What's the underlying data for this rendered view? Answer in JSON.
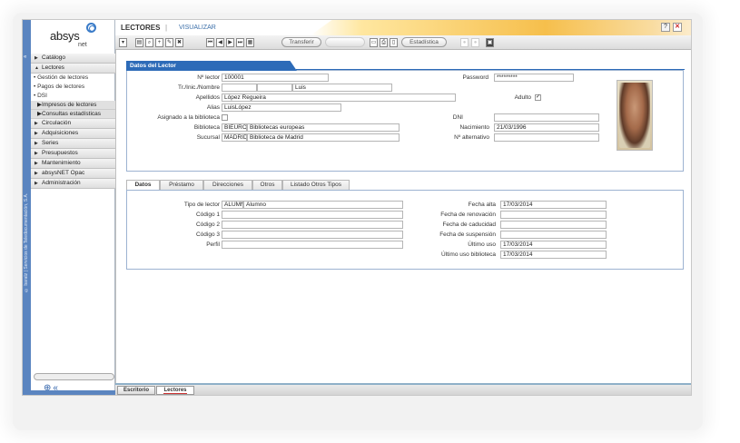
{
  "app": {
    "logo_word": "absys",
    "logo_suffix": "net",
    "vertical_credit": "© baratz | Servicios de Teledocumentación, S.A."
  },
  "window": {
    "module_title": "LECTORES",
    "separator": "|",
    "mode": "VISUALIZAR",
    "help_label": "?",
    "close_label": "✕"
  },
  "toolbar": {
    "transfer_label": "Transferir",
    "stats_label": "Estadística"
  },
  "sidebar": {
    "items": [
      {
        "label": "Catálogo",
        "expanded": false
      },
      {
        "label": "Lectores",
        "expanded": true
      },
      {
        "label": "Gestión de lectores",
        "type": "link"
      },
      {
        "label": "Pagos de lectores",
        "type": "link"
      },
      {
        "label": "DSI",
        "type": "link"
      },
      {
        "label": "Impresos de lectores",
        "type": "sub"
      },
      {
        "label": "Consultas estadísticas",
        "type": "sub"
      },
      {
        "label": "Circulación",
        "expanded": false
      },
      {
        "label": "Adquisiciones",
        "expanded": false
      },
      {
        "label": "Series",
        "expanded": false
      },
      {
        "label": "Presupuestos",
        "expanded": false
      },
      {
        "label": "Mantenimiento",
        "expanded": false
      },
      {
        "label": "absysNET Opac",
        "expanded": false
      },
      {
        "label": "Administración",
        "expanded": false
      }
    ]
  },
  "lector": {
    "panel_title": "Datos del Lector",
    "n_lector_label": "Nº lector",
    "n_lector_value": "100001",
    "password_label": "Password",
    "password_value": "*********",
    "tr_label": "Tr./Inic./Nombre",
    "tr_value": "",
    "inic_value": "",
    "nombre_value": "Luis",
    "apellidos_label": "Apellidos",
    "apellidos_value": "López Regueira",
    "adulto_label": "Adulto",
    "adulto_checked": "✓",
    "alias_label": "Alias",
    "alias_value": "LuisLópez",
    "asignado_label": "Asignado a la biblioteca",
    "dni_label": "DNI",
    "dni_value": "",
    "biblioteca_label": "Biblioteca",
    "biblioteca_code": "BIEURO",
    "biblioteca_name": "Bibliotecas europeas",
    "nacimiento_label": "Nacimiento",
    "nacimiento_value": "21/03/1996",
    "sucursal_label": "Sucursal",
    "sucursal_code": "MADRID",
    "sucursal_name": "Biblioteca de Madrid",
    "alternativo_label": "Nº alternativo",
    "alternativo_value": ""
  },
  "tabs": [
    "Datos",
    "Préstamo",
    "Direcciones",
    "Otros",
    "Listado Otros Tipos"
  ],
  "datos": {
    "tipo_label": "Tipo de lector",
    "tipo_code": "ALUMN",
    "tipo_name": "Alumno",
    "codigo1_label": "Código 1",
    "codigo2_label": "Código 2",
    "codigo3_label": "Código 3",
    "perfil_label": "Perfil",
    "fecha_alta_label": "Fecha alta",
    "fecha_alta_value": "17/03/2014",
    "renovacion_label": "Fecha de renovación",
    "renovacion_value": "",
    "caducidad_label": "Fecha de caducidad",
    "caducidad_value": "",
    "suspension_label": "Fecha de suspensión",
    "suspension_value": "",
    "ultimo_uso_label": "Último uso",
    "ultimo_uso_value": "17/03/2014",
    "ultimo_uso_bib_label": "Último uso biblioteca",
    "ultimo_uso_bib_value": "17/03/2014"
  },
  "bottom_tabs": [
    "Escritorio",
    "Lectores"
  ],
  "colors": {
    "accent": "#2d6bb8",
    "strip": "#5b85c0",
    "title_gradient": "#f6bf4c"
  }
}
